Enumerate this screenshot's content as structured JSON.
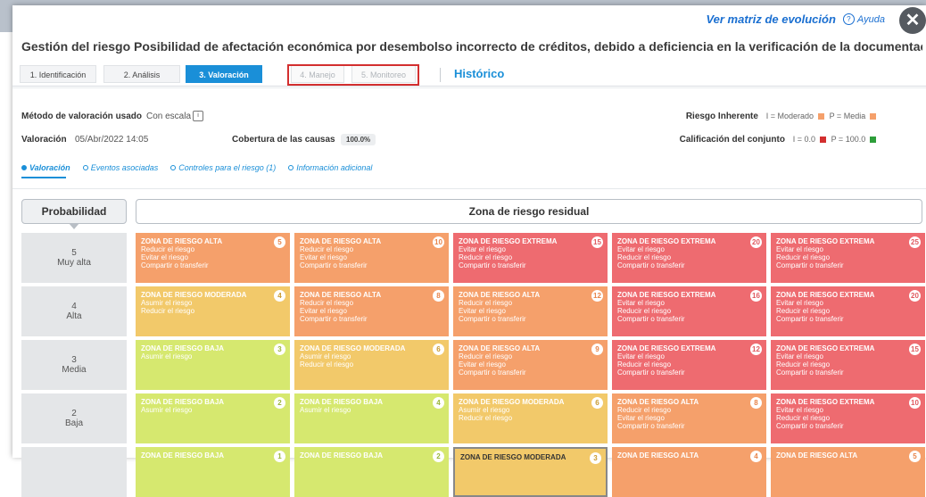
{
  "modal": {
    "evolution_link": "Ver matriz de evolución",
    "help_label": "Ayuda",
    "close_label": "✕",
    "title": "Gestión del riesgo Posibilidad de afectación económica por desembolso incorrecto de créditos, debido a deficiencia en la verificación de la documentación soporte del usuario"
  },
  "tabs": [
    {
      "label": "1. Identificación",
      "state": "normal"
    },
    {
      "label": "2. Análisis",
      "state": "normal"
    },
    {
      "label": "3. Valoración",
      "state": "active"
    },
    {
      "label": "4. Manejo",
      "state": "disabled"
    },
    {
      "label": "5. Monitoreo",
      "state": "disabled"
    }
  ],
  "historico_label": "Histórico",
  "info": {
    "metodo_label": "Método de valoración usado",
    "metodo_value": "Con escala",
    "valoracion_label": "Valoración",
    "valoracion_value": "05/Abr/2022 14:05",
    "cobertura_label": "Cobertura de las causas",
    "cobertura_value": "100.0%",
    "inherente_label": "Riesgo Inherente",
    "inherente_i": "I = Moderado",
    "inherente_p": "P = Media",
    "calificacion_label": "Calificación del conjunto",
    "calificacion_i": "I = 0.0",
    "calificacion_p": "P = 100.0"
  },
  "subtabs": [
    {
      "label": "Valoración",
      "active": true
    },
    {
      "label": "Eventos asociadas",
      "active": false
    },
    {
      "label": "Controles para el riesgo (1)",
      "active": false
    },
    {
      "label": "Información adicional",
      "active": false
    }
  ],
  "matrix": {
    "prob_header": "Probabilidad",
    "zona_header": "Zona de riesgo residual",
    "rows": [
      {
        "level": "5",
        "name": "Muy alta",
        "cells": [
          {
            "zone": "ZONA DE RIESGO ALTA",
            "score": "5",
            "color": "#f5a06b",
            "actions": [
              "Reducir el riesgo",
              "Evitar el riesgo",
              "Compartir o transferir"
            ]
          },
          {
            "zone": "ZONA DE RIESGO ALTA",
            "score": "10",
            "color": "#f5a06b",
            "actions": [
              "Reducir el riesgo",
              "Evitar el riesgo",
              "Compartir o transferir"
            ]
          },
          {
            "zone": "ZONA DE RIESGO EXTREMA",
            "score": "15",
            "color": "#ee6b70",
            "actions": [
              "Evitar el riesgo",
              "Reducir el riesgo",
              "Compartir o transferir"
            ]
          },
          {
            "zone": "ZONA DE RIESGO EXTREMA",
            "score": "20",
            "color": "#ee6b70",
            "actions": [
              "Evitar el riesgo",
              "Reducir el riesgo",
              "Compartir o transferir"
            ]
          },
          {
            "zone": "ZONA DE RIESGO EXTREMA",
            "score": "25",
            "color": "#ee6b70",
            "actions": [
              "Evitar el riesgo",
              "Reducir el riesgo",
              "Compartir o transferir"
            ]
          }
        ]
      },
      {
        "level": "4",
        "name": "Alta",
        "cells": [
          {
            "zone": "ZONA DE RIESGO MODERADA",
            "score": "4",
            "color": "#f2c96a",
            "actions": [
              "Asumir el riesgo",
              "Reducir el riesgo"
            ]
          },
          {
            "zone": "ZONA DE RIESGO ALTA",
            "score": "8",
            "color": "#f5a06b",
            "actions": [
              "Reducir el riesgo",
              "Evitar el riesgo",
              "Compartir o transferir"
            ]
          },
          {
            "zone": "ZONA DE RIESGO ALTA",
            "score": "12",
            "color": "#f5a06b",
            "actions": [
              "Reducir el riesgo",
              "Evitar el riesgo",
              "Compartir o transferir"
            ]
          },
          {
            "zone": "ZONA DE RIESGO EXTREMA",
            "score": "16",
            "color": "#ee6b70",
            "actions": [
              "Evitar el riesgo",
              "Reducir el riesgo",
              "Compartir o transferir"
            ]
          },
          {
            "zone": "ZONA DE RIESGO EXTREMA",
            "score": "20",
            "color": "#ee6b70",
            "actions": [
              "Evitar el riesgo",
              "Reducir el riesgo",
              "Compartir o transferir"
            ]
          }
        ]
      },
      {
        "level": "3",
        "name": "Media",
        "cells": [
          {
            "zone": "ZONA DE RIESGO BAJA",
            "score": "3",
            "color": "#d6e86f",
            "actions": [
              "Asumir el riesgo"
            ]
          },
          {
            "zone": "ZONA DE RIESGO MODERADA",
            "score": "6",
            "color": "#f2c96a",
            "actions": [
              "Asumir el riesgo",
              "Reducir el riesgo"
            ]
          },
          {
            "zone": "ZONA DE RIESGO ALTA",
            "score": "9",
            "color": "#f5a06b",
            "actions": [
              "Reducir el riesgo",
              "Evitar el riesgo",
              "Compartir o transferir"
            ]
          },
          {
            "zone": "ZONA DE RIESGO EXTREMA",
            "score": "12",
            "color": "#ee6b70",
            "actions": [
              "Evitar el riesgo",
              "Reducir el riesgo",
              "Compartir o transferir"
            ]
          },
          {
            "zone": "ZONA DE RIESGO EXTREMA",
            "score": "15",
            "color": "#ee6b70",
            "actions": [
              "Evitar el riesgo",
              "Reducir el riesgo",
              "Compartir o transferir"
            ]
          }
        ]
      },
      {
        "level": "2",
        "name": "Baja",
        "cells": [
          {
            "zone": "ZONA DE RIESGO BAJA",
            "score": "2",
            "color": "#d6e86f",
            "actions": [
              "Asumir el riesgo"
            ]
          },
          {
            "zone": "ZONA DE RIESGO BAJA",
            "score": "4",
            "color": "#d6e86f",
            "actions": [
              "Asumir el riesgo"
            ]
          },
          {
            "zone": "ZONA DE RIESGO MODERADA",
            "score": "6",
            "color": "#f2c96a",
            "actions": [
              "Asumir el riesgo",
              "Reducir el riesgo"
            ]
          },
          {
            "zone": "ZONA DE RIESGO ALTA",
            "score": "8",
            "color": "#f5a06b",
            "actions": [
              "Reducir el riesgo",
              "Evitar el riesgo",
              "Compartir o transferir"
            ]
          },
          {
            "zone": "ZONA DE RIESGO EXTREMA",
            "score": "10",
            "color": "#ee6b70",
            "actions": [
              "Evitar el riesgo",
              "Reducir el riesgo",
              "Compartir o transferir"
            ]
          }
        ]
      },
      {
        "level": "",
        "name": "",
        "cells": [
          {
            "zone": "ZONA DE RIESGO BAJA",
            "score": "1",
            "color": "#d6e86f",
            "actions": []
          },
          {
            "zone": "ZONA DE RIESGO BAJA",
            "score": "2",
            "color": "#d6e86f",
            "actions": []
          },
          {
            "zone": "ZONA DE RIESGO MODERADA",
            "score": "3",
            "color": "#f2c96a",
            "actions": [],
            "selected": true,
            "dark_text": true
          },
          {
            "zone": "ZONA DE RIESGO ALTA",
            "score": "4",
            "color": "#f5a06b",
            "actions": []
          },
          {
            "zone": "ZONA DE RIESGO ALTA",
            "score": "5",
            "color": "#f5a06b",
            "actions": []
          }
        ]
      }
    ]
  },
  "colors": {
    "accent": "#1a8fd8",
    "link": "#1a6fd1",
    "moderado": "#f5a06b",
    "media": "#f5a06b",
    "cal_i": "#d32f2f",
    "cal_p": "#2e9e3a",
    "highlight_box": "#d32f2f"
  }
}
